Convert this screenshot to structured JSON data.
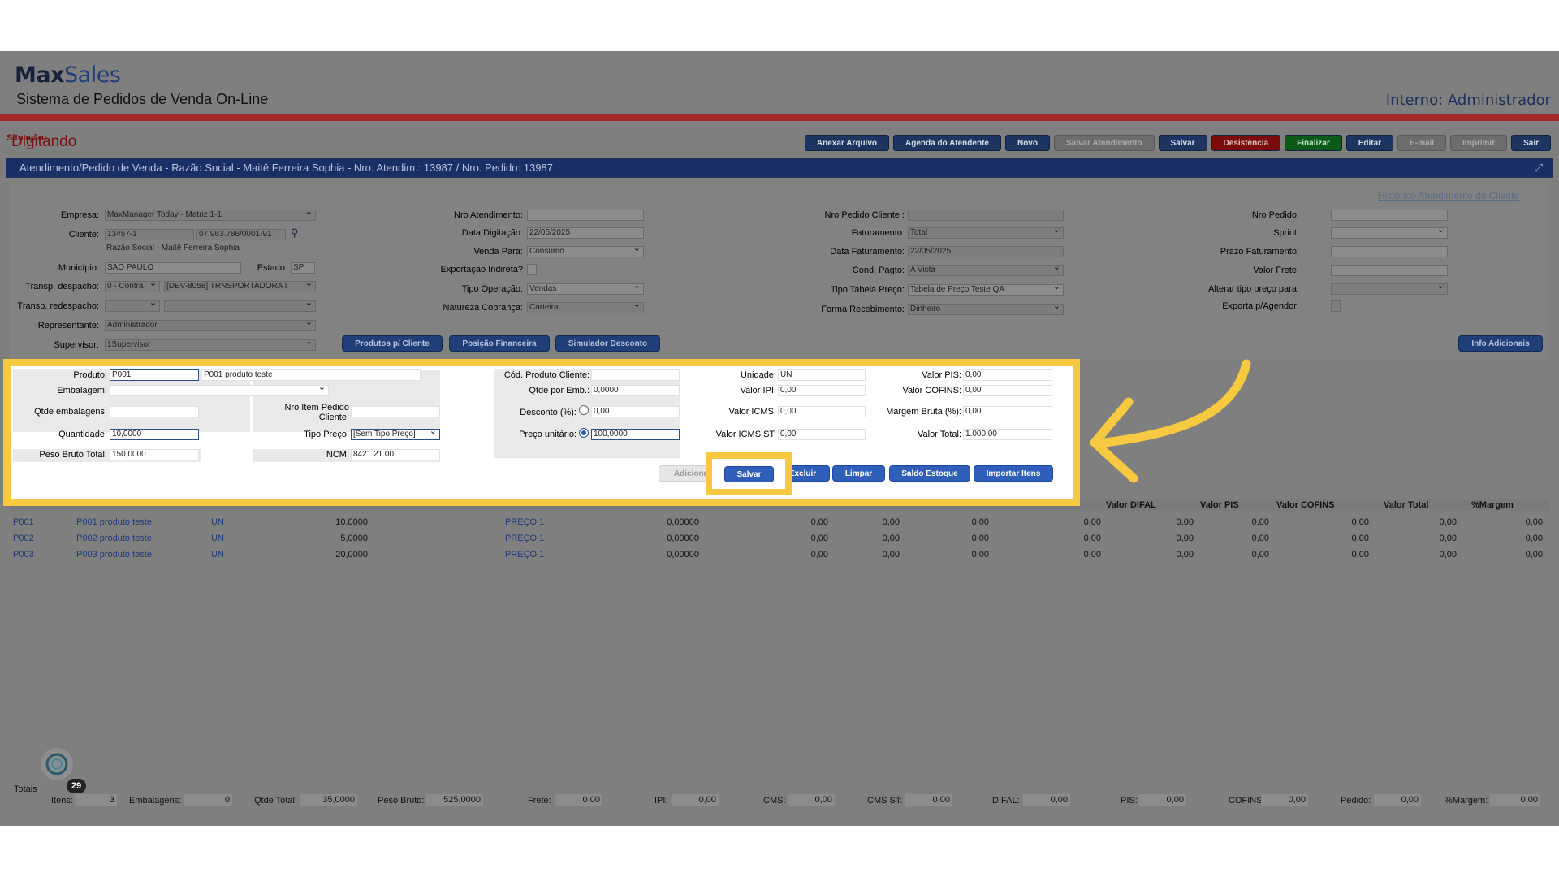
{
  "app": {
    "logo_max": "Max",
    "logo_sales": "Sales",
    "subtitle": "Sistema de Pedidos de Venda On-Line",
    "user": "Interno: Administrador"
  },
  "status": {
    "label": "Situação:",
    "value": "Digitando"
  },
  "toolbar": [
    "Anexar Arquivo",
    "Agenda do Atendente",
    "Novo",
    "Salvar Atendimento",
    "Salvar",
    "Desistência",
    "Finalizar",
    "Editar",
    "E-mail",
    "Imprimir",
    "Sair"
  ],
  "title": "Atendimento/Pedido de Venda - Razão Social - Maitê Ferreira Sophia - Nro. Atendim.: 13987 / Nro. Pedido: 13987",
  "historico_link": "Histórico Atendimento do Cliente",
  "form": {
    "empresa_label": "Empresa:",
    "empresa": "MaxManager Today - Matriz 1-1",
    "cliente_label": "Cliente:",
    "cliente_cod": "13457-1",
    "cliente_cnpj": "07.963.786/0001-91",
    "razao": "Razão Social - Maitê Ferreira Sophia",
    "municipio_label": "Município:",
    "municipio": "SAO PAULO",
    "estado_label": "Estado:",
    "estado": "SP",
    "transp_despacho_label": "Transp. despacho:",
    "transp_tipo": "0 - Contra",
    "transp_despacho": "[DEV-8058] TRNSPORTADORA I",
    "transp_redespacho_label": "Transp. redespacho:",
    "representante_label": "Representante:",
    "representante": "Administrador",
    "supervisor_label": "Supervisor:",
    "supervisor": "1Supervisor",
    "nro_atendimento_label": "Nro Atendimento:",
    "data_digitacao_label": "Data Digitação:",
    "data_digitacao": "22/05/2025",
    "venda_para_label": "Venda Para:",
    "venda_para": "Consumo",
    "exportacao_label": "Exportação Indireta?",
    "tipo_operacao_label": "Tipo Operação:",
    "tipo_operacao": "Vendas",
    "natureza_label": "Natureza Cobrança:",
    "natureza": "Carteira",
    "nro_pedido_cliente_label": "Nro Pedido Cliente :",
    "faturamento_label": "Faturamento:",
    "faturamento": "Total",
    "data_faturamento_label": "Data Faturamento:",
    "data_faturamento": "22/05/2025",
    "cond_pagto_label": "Cond. Pagto:",
    "cond_pagto": "A Vista",
    "tipo_tabela_label": "Tipo Tabela Preço:",
    "tipo_tabela": "Tabela de Preço Teste QA",
    "forma_recebimento_label": "Forma Recebimento:",
    "forma_recebimento": "Dinheiro",
    "nro_pedido_label": "Nro Pedido:",
    "sprint_label": "Sprint:",
    "prazo_label": "Prazo Faturamento:",
    "valor_frete_label": "Valor Frete:",
    "alterar_label": "Alterar tipo preço para:",
    "exporta_label": "Exporta p/Agendor:"
  },
  "mid_buttons": [
    "Produtos p/ Cliente",
    "Posição Financeira",
    "Simulador Desconto",
    "Info Adicionais"
  ],
  "item_panel": {
    "produto_label": "Produto:",
    "produto_cod": "P001",
    "produto_desc": "P001 produto teste",
    "embalagem_label": "Embalagem:",
    "qtde_emb_label": "Qtde embalagens:",
    "nro_item_label_1": "Nro Item Pedido",
    "nro_item_label_2": "Cliente:",
    "quantidade_label": "Quantidade:",
    "quantidade": "10,0000",
    "tipo_preco_label": "Tipo Preço:",
    "tipo_preco": "[Sem Tipo Preço]",
    "peso_label": "Peso Bruto Total:",
    "peso": "150,0000",
    "ncm_label": "NCM:",
    "ncm": "8421.21.00",
    "cod_prod_cliente_label": "Cód. Produto Cliente:",
    "qtde_emb_por_label": "Qtde por Emb.:",
    "qtde_emb_por": "0,0000",
    "desconto_label": "Desconto (%):",
    "desconto": "0,00",
    "preco_label": "Preço unitário:",
    "preco": "100,0000",
    "unidade_label": "Unidade:",
    "unidade": "UN",
    "valor_ipi_label": "Valor IPI:",
    "valor_ipi": "0,00",
    "valor_icms_label": "Valor ICMS:",
    "valor_icms": "0,00",
    "valor_icms_st_label": "Valor ICMS ST:",
    "valor_icms_st": "0,00",
    "valor_pis_label": "Valor PIS:",
    "valor_pis": "0,00",
    "valor_cofins_label": "Valor COFINS:",
    "valor_cofins": "0,00",
    "margem_label": "Margem Bruta (%):",
    "margem": "0,00",
    "valor_total_label": "Valor Total:",
    "valor_total": "1.000,00",
    "buttons": {
      "adicionar": "Adiciona",
      "salvar": "Salvar",
      "excluir": "Excluir",
      "limpar": "Limpar",
      "saldo": "Saldo Estoque",
      "importar": "Importar Itens"
    }
  },
  "grid": {
    "headers": [
      "Valor DIFAL",
      "Valor PIS",
      "Valor COFINS",
      "Valor Total",
      "%Margem"
    ],
    "rows": [
      {
        "cod": "P001",
        "desc": "P001 produto teste",
        "un": "UN",
        "qtd": "10,0000",
        "tipo": "PREÇO 1",
        "preco": "0,00000",
        "v1": "0,00",
        "v2": "0,00",
        "v3": "0,00",
        "v4": "0,00",
        "v5": "0,00",
        "v6": "0,00",
        "v7": "0,00",
        "v8": "0,00",
        "v9": "0,00"
      },
      {
        "cod": "P002",
        "desc": "P002 produto teste",
        "un": "UN",
        "qtd": "5,0000",
        "tipo": "PREÇO 1",
        "preco": "0,00000",
        "v1": "0,00",
        "v2": "0,00",
        "v3": "0,00",
        "v4": "0,00",
        "v5": "0,00",
        "v6": "0,00",
        "v7": "0,00",
        "v8": "0,00",
        "v9": "0,00"
      },
      {
        "cod": "P003",
        "desc": "P003 produto teste",
        "un": "UN",
        "qtd": "20,0000",
        "tipo": "PREÇO 1",
        "preco": "0,00000",
        "v1": "0,00",
        "v2": "0,00",
        "v3": "0,00",
        "v4": "0,00",
        "v5": "0,00",
        "v6": "0,00",
        "v7": "0,00",
        "v8": "0,00",
        "v9": "0,00"
      }
    ]
  },
  "totals": {
    "label": "Totais",
    "badge": "29",
    "itens_label": "Itens:",
    "itens": "3",
    "embalagens_label": "Embalagens:",
    "embalagens": "0",
    "qtde_label": "Qtde Total:",
    "qtde": "35,0000",
    "peso_label": "Peso Bruto:",
    "peso": "525,0000",
    "frete_label": "Frete:",
    "frete": "0,00",
    "ipi_label": "IPI:",
    "ipi": "0,00",
    "icms_label": "ICMS:",
    "icms": "0,00",
    "icms_st_label": "ICMS ST:",
    "icms_st": "0,00",
    "difal_label": "DIFAL:",
    "difal": "0,00",
    "pis_label": "PIS:",
    "pis": "0,00",
    "cofins_label": "COFINS:",
    "cofins": "0,00",
    "pedido_label": "Pedido:",
    "pedido": "0,00",
    "margem_label": "%Margem:",
    "margem": "0,00"
  },
  "colors": {
    "highlight": "#f7c940",
    "header_bar": "#1a2f66",
    "red_bar": "#a52a2a",
    "primary_button": "#2f5fb8"
  }
}
